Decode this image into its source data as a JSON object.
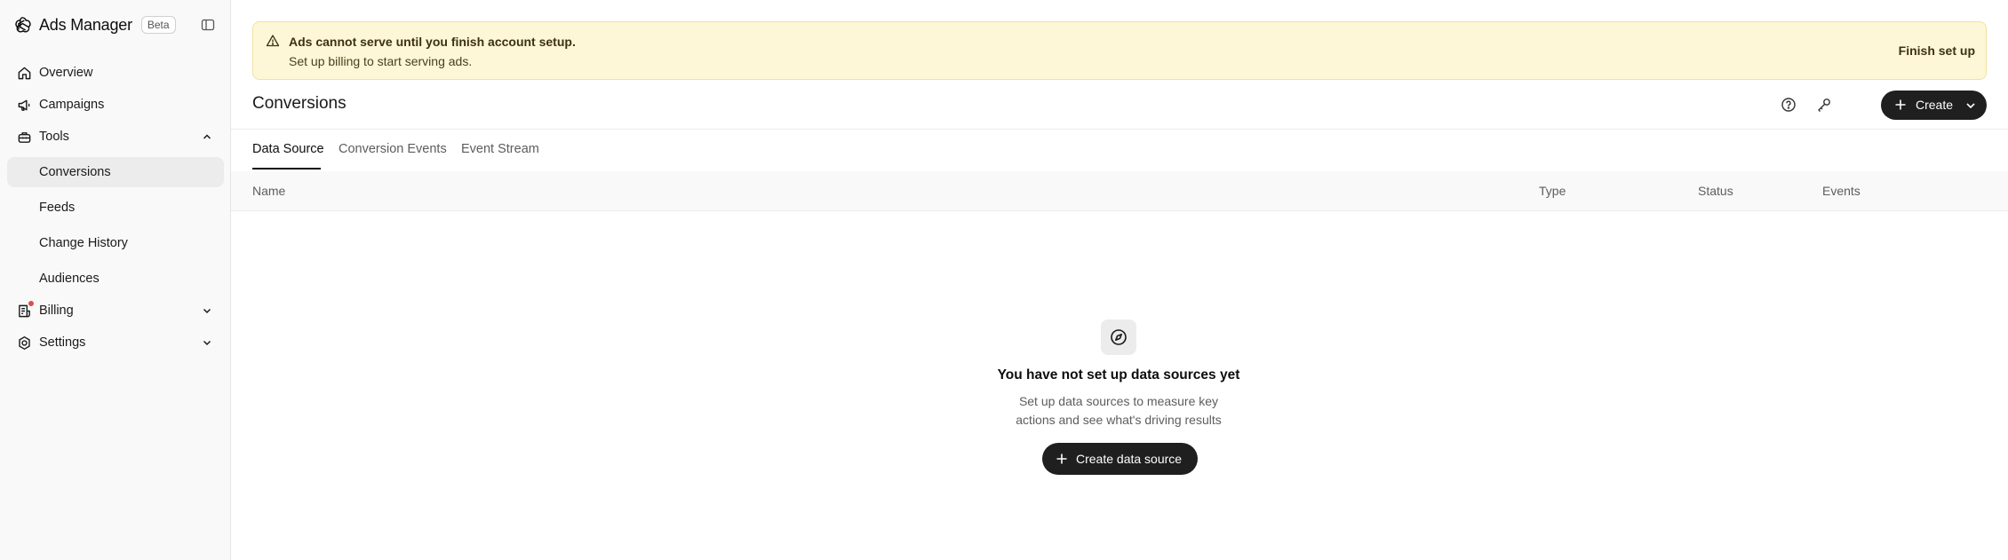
{
  "app": {
    "title": "Ads Manager",
    "badge": "Beta"
  },
  "sidebar": {
    "items": [
      {
        "label": "Overview",
        "icon": "home-icon"
      },
      {
        "label": "Campaigns",
        "icon": "megaphone-icon"
      },
      {
        "label": "Tools",
        "icon": "toolbox-icon",
        "expanded": true
      },
      {
        "label": "Conversions",
        "active": true
      },
      {
        "label": "Feeds"
      },
      {
        "label": "Change History"
      },
      {
        "label": "Audiences"
      },
      {
        "label": "Billing",
        "icon": "billing-icon",
        "notification": true
      },
      {
        "label": "Settings",
        "icon": "gear-icon"
      }
    ]
  },
  "banner": {
    "title": "Ads cannot serve until you finish account setup.",
    "subtitle": "Set up billing to start serving ads.",
    "action": "Finish set up",
    "color": "#fdf7d8"
  },
  "header": {
    "title": "Conversions",
    "create_label": "Create"
  },
  "tabs": [
    {
      "label": "Data Source",
      "active": true
    },
    {
      "label": "Conversion Events"
    },
    {
      "label": "Event Stream"
    }
  ],
  "table": {
    "columns": [
      "Name",
      "Type",
      "Status",
      "Events"
    ]
  },
  "empty_state": {
    "title": "You have not set up data sources yet",
    "description": "Set up data sources to measure key actions and see what's driving results",
    "button": "Create data source"
  },
  "colors": {
    "primary_button": "#1f1f1f",
    "notification_dot": "#e5484d",
    "sidebar_bg": "#f9f9f9"
  }
}
